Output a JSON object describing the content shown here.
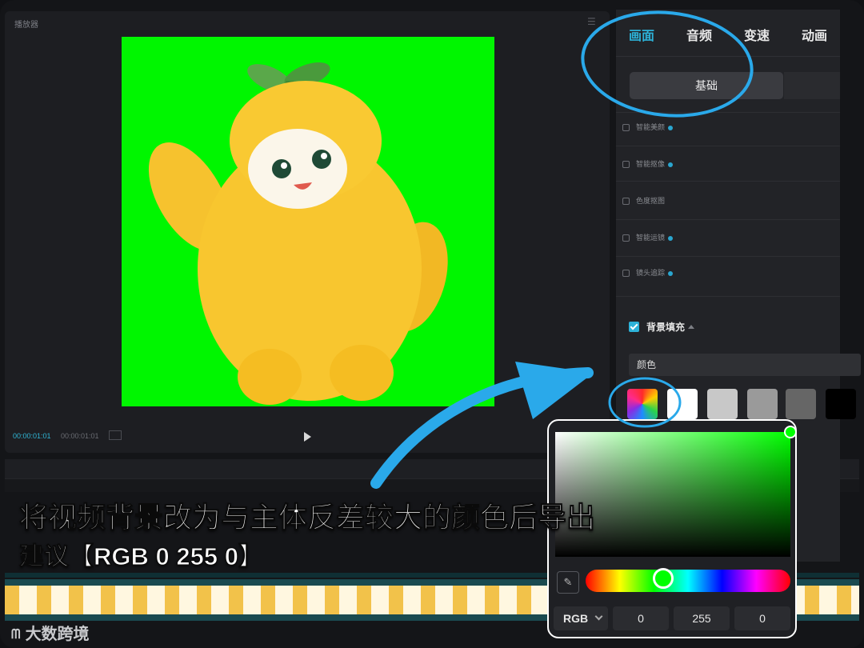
{
  "player": {
    "title": "播放器",
    "current_time": "00:00:01:01",
    "total_time": "00:00:01:01"
  },
  "panel": {
    "tabs": [
      "画面",
      "音频",
      "变速",
      "动画"
    ],
    "active_tab": "画面",
    "subtab": "基础",
    "options": [
      "智能美颜",
      "智能抠像",
      "色度抠图",
      "智能运镜",
      "镜头追踪"
    ],
    "background_fill_label": "背景填充",
    "fill_type": "颜色",
    "swatches": [
      "#ffffff",
      "#c8c8c8",
      "#9a9a9a",
      "#666666",
      "#000000"
    ]
  },
  "color_picker": {
    "mode": "RGB",
    "r": "0",
    "g": "255",
    "b": "0",
    "selected_color": "#00ff00"
  },
  "annotations": {
    "caption_line1": "将视频背景改为与主体反差较大的颜色后导出",
    "caption_line2": "建议【RGB 0 255 0】",
    "accent_color": "#2aa9ea"
  },
  "watermark": "大数跨境"
}
